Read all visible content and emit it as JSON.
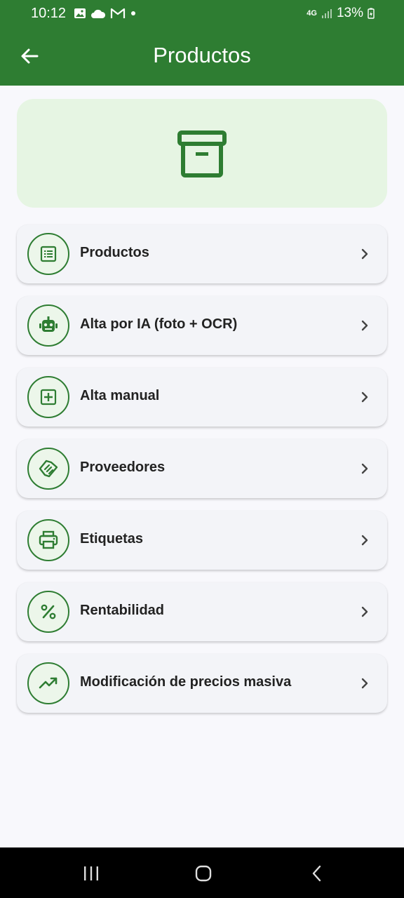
{
  "status_bar": {
    "time": "10:12",
    "network": "4G",
    "battery": "13%"
  },
  "header": {
    "title": "Productos"
  },
  "menu": {
    "items": [
      {
        "label": "Productos",
        "icon": "list-icon"
      },
      {
        "label": "Alta por IA (foto + OCR)",
        "icon": "robot-icon"
      },
      {
        "label": "Alta manual",
        "icon": "add-box-icon"
      },
      {
        "label": "Proveedores",
        "icon": "handshake-icon"
      },
      {
        "label": "Etiquetas",
        "icon": "printer-icon"
      },
      {
        "label": "Rentabilidad",
        "icon": "percent-icon"
      },
      {
        "label": "Modificación de precios masiva",
        "icon": "trending-up-icon"
      }
    ]
  },
  "colors": {
    "primary": "#2e7d32",
    "hero_bg": "#e6f5e3",
    "card_bg": "#f3f4f8",
    "page_bg": "#f8f8fc"
  }
}
